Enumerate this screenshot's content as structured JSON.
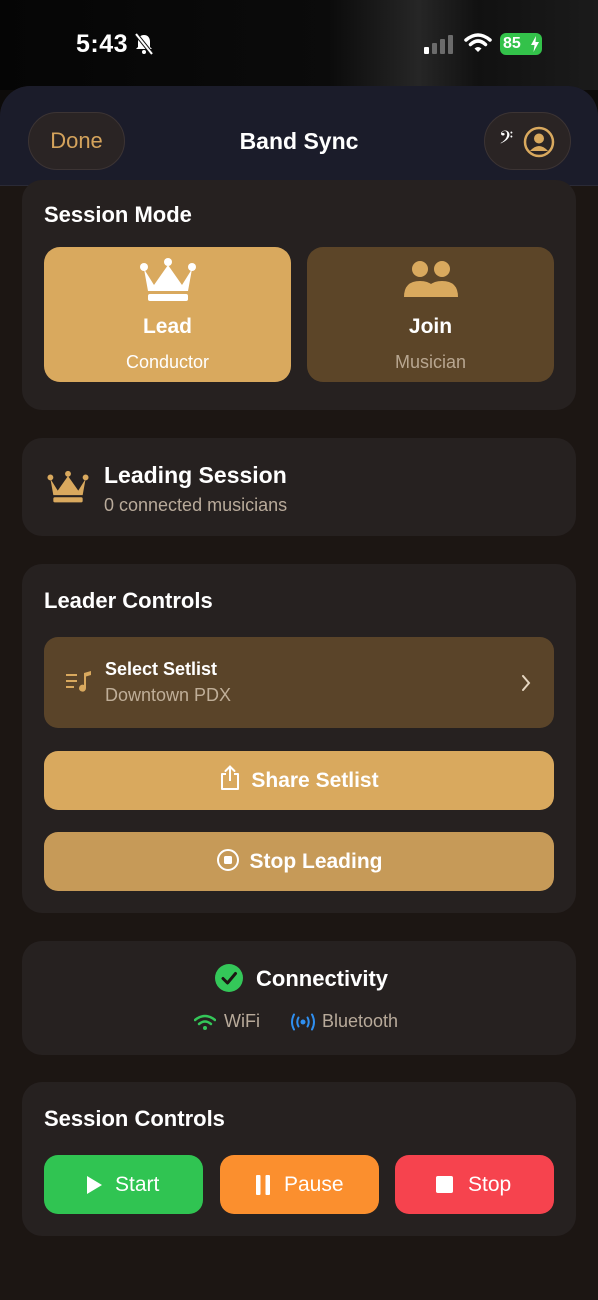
{
  "status": {
    "time": "5:43",
    "battery": "85"
  },
  "nav": {
    "done_label": "Done",
    "title": "Band Sync",
    "clef_glyph": "𝄢"
  },
  "session_mode": {
    "title": "Session Mode",
    "lead": {
      "label": "Lead",
      "sub": "Conductor"
    },
    "join": {
      "label": "Join",
      "sub": "Musician"
    }
  },
  "leading_session": {
    "title": "Leading Session",
    "sub": "0 connected musicians"
  },
  "leader_controls": {
    "title": "Leader Controls",
    "setlist_label": "Select Setlist",
    "setlist_value": "Downtown PDX",
    "share_label": "Share Setlist",
    "stop_leading_label": "Stop Leading"
  },
  "connectivity": {
    "title": "Connectivity",
    "wifi_label": "WiFi",
    "bluetooth_label": "Bluetooth"
  },
  "session_controls": {
    "title": "Session Controls",
    "start_label": "Start",
    "pause_label": "Pause",
    "stop_label": "Stop"
  },
  "colors": {
    "accent": "#d9a95e",
    "tile_inactive": "#5c4528",
    "card": "#262120",
    "start": "#30c452",
    "pause": "#fb8f2e",
    "stop": "#f6434e",
    "connected_green": "#34c759",
    "bluetooth_blue": "#2f8ff0"
  }
}
